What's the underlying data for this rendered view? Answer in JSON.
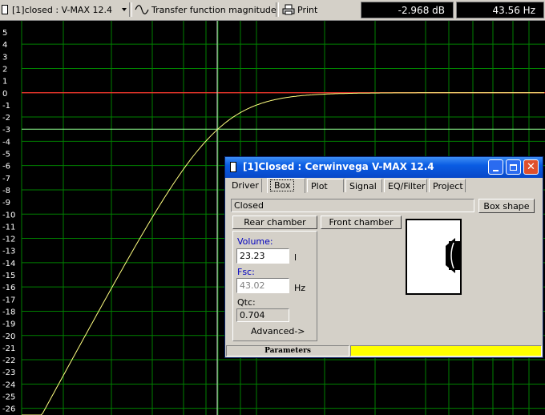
{
  "toolbar": {
    "project_select": "[1]closed : V-MAX 12.4",
    "graph_select": "Transfer function magnitude",
    "print_label": "Print",
    "readout_db": "-2.968 dB",
    "readout_hz": "43.56 Hz"
  },
  "plot": {
    "y_ticks": [
      "5",
      "4",
      "3",
      "2",
      "1",
      "0",
      "-1",
      "-2",
      "-3",
      "-4",
      "-5",
      "-6",
      "-7",
      "-8",
      "-9",
      "-10",
      "-11",
      "-12",
      "-13",
      "-14",
      "-15",
      "-16",
      "-17",
      "-18",
      "-19",
      "-20",
      "-21",
      "-22",
      "-23",
      "-24",
      "-25",
      "-26"
    ],
    "colors": {
      "background": "#000000",
      "grid": "#008000",
      "zero_line": "#ff3030",
      "minus3_line": "#90ff90",
      "curve": "#ffff80"
    }
  },
  "dialog": {
    "title": "[1]Closed : Cerwinvega  V-MAX 12.4",
    "tabs": [
      "Driver",
      "Box",
      "Plot",
      "Signal",
      "EQ/Filter",
      "Project"
    ],
    "selected_tab": "Box",
    "box_type": "Closed",
    "box_shape_button": "Box shape",
    "rear_chamber_button": "Rear chamber",
    "front_chamber_button": "Front chamber",
    "volume_label": "Volume:",
    "volume_value": "23.23",
    "volume_unit": "l",
    "fsc_label": "Fsc:",
    "fsc_value": "43.02",
    "fsc_unit": "Hz",
    "qtc_label": "Qtc:",
    "qtc_value": "0.704",
    "advanced_button": "Advanced->",
    "status_label": "Parameters",
    "status_color": "#ffff00"
  }
}
